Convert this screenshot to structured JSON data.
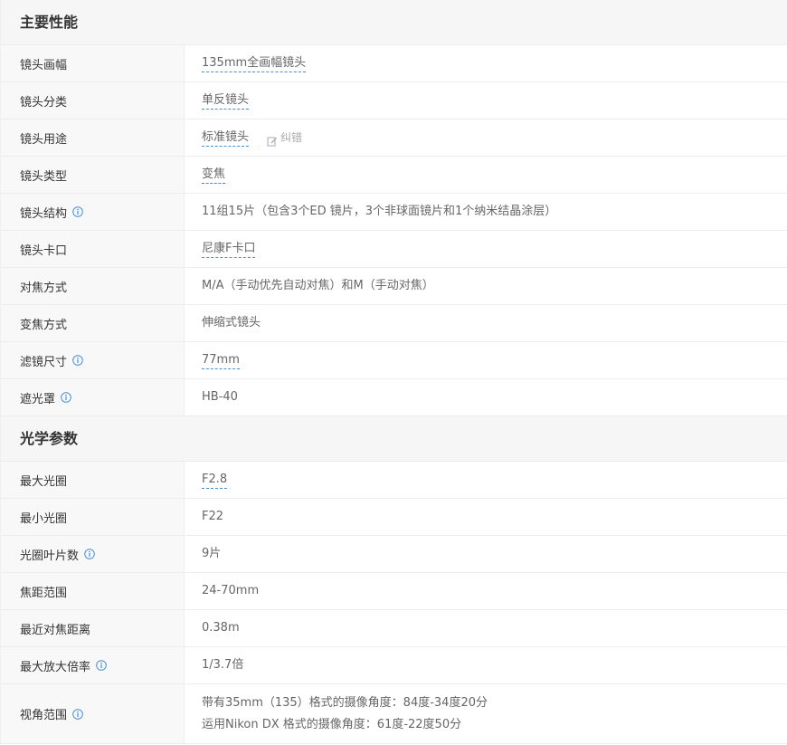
{
  "sections": [
    {
      "title": "主要性能",
      "rows": [
        {
          "label": "镜头画幅",
          "value": "135mm全画幅镜头",
          "link": true
        },
        {
          "label": "镜头分类",
          "value": "单反镜头",
          "link": true
        },
        {
          "label": "镜头用途",
          "value": "标准镜头",
          "link": true,
          "correct": "纠错"
        },
        {
          "label": "镜头类型",
          "value": "变焦",
          "link": true
        },
        {
          "label": "镜头结构",
          "info": true,
          "value": "11组15片（包含3个ED 镜片，3个非球面镜片和1个纳米结晶涂层）"
        },
        {
          "label": "镜头卡口",
          "value": "尼康F卡口",
          "link": true
        },
        {
          "label": "对焦方式",
          "value": "M/A（手动优先自动对焦）和M（手动对焦）"
        },
        {
          "label": "变焦方式",
          "value": "伸缩式镜头"
        },
        {
          "label": "滤镜尺寸",
          "info": true,
          "value": "77mm",
          "link": true
        },
        {
          "label": "遮光罩",
          "info": true,
          "value": "HB-40"
        }
      ]
    },
    {
      "title": "光学参数",
      "rows": [
        {
          "label": "最大光圈",
          "value": "F2.8",
          "link": true
        },
        {
          "label": "最小光圈",
          "value": "F22"
        },
        {
          "label": "光圈叶片数",
          "info": true,
          "value": "9片"
        },
        {
          "label": "焦距范围",
          "value": "24-70mm"
        },
        {
          "label": "最近对焦距离",
          "value": "0.38m"
        },
        {
          "label": "最大放大倍率",
          "info": true,
          "value": "1/3.7倍"
        },
        {
          "label": "视角范围",
          "info": true,
          "lines": [
            "带有35mm（135）格式的摄像角度：84度-34度20分",
            "运用Nikon DX 格式的摄像角度：61度-22度50分"
          ]
        }
      ]
    }
  ],
  "colors": {
    "link_underline": "#3d8fd8",
    "info_icon": "#4a90d9",
    "label_bg": "#f8f8f8",
    "header_bg": "#f6f6f6"
  },
  "icons": {
    "info": "info-icon",
    "edit": "edit-icon"
  }
}
